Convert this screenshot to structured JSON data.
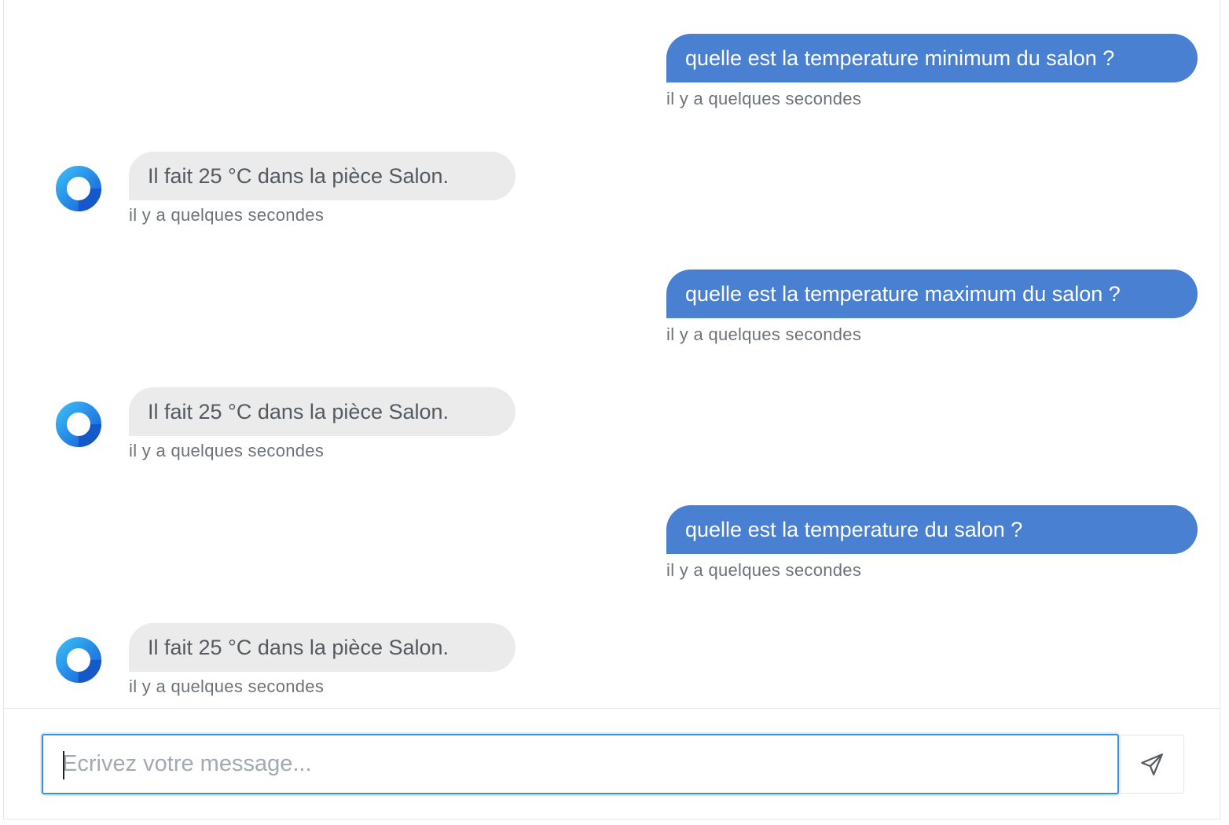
{
  "conversation": [
    {
      "role": "user",
      "text": "quelle est la temperature minimum du salon ?",
      "time": "il y a quelques secondes"
    },
    {
      "role": "bot",
      "text": "Il fait 25 °C dans la pièce Salon.",
      "time": "il y a quelques secondes"
    },
    {
      "role": "user",
      "text": "quelle est la temperature maximum du salon ?",
      "time": "il y a quelques secondes"
    },
    {
      "role": "bot",
      "text": "Il fait 25 °C dans la pièce Salon.",
      "time": "il y a quelques secondes"
    },
    {
      "role": "user",
      "text": "quelle est la temperature du salon ?",
      "time": "il y a quelques secondes"
    },
    {
      "role": "bot",
      "text": "Il fait 25 °C dans la pièce Salon.",
      "time": "il y a quelques secondes"
    }
  ],
  "composer": {
    "placeholder": "Ecrivez votre message...",
    "value": "",
    "send_icon": "send-icon"
  },
  "colors": {
    "user_bubble": "#4a80d1",
    "bot_bubble": "#ebebeb",
    "focus_border": "#3a8fd9"
  }
}
